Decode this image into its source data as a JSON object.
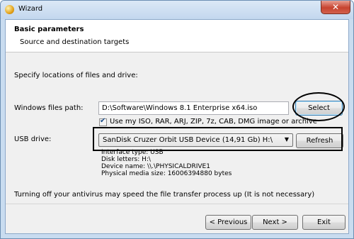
{
  "window": {
    "title": "Wizard",
    "close_label": "✕"
  },
  "header": {
    "title": "Basic parameters",
    "subtitle": "Source and destination targets"
  },
  "main": {
    "instruction": "Specify locations of files and drive:",
    "files_path_label": "Windows files path:",
    "files_path_value": "D:\\Software\\Windows 8.1 Enterprise x64.iso",
    "select_label": "Select",
    "use_images_checked": true,
    "use_images_label": "Use my ISO, RAR, ARJ, ZIP, 7z, CAB, DMG image or archive",
    "usb_label": "USB drive:",
    "usb_selected": "SanDisk Cruzer Orbit USB Device (14,91 Gb) H:\\",
    "refresh_label": "Refresh",
    "drive_info": {
      "interface": "Interface type: USB",
      "letters": "Disk letters: H:\\",
      "device": "Device name: \\\\.\\PHYSICALDRIVE1",
      "size": "Physical media size: 16006394880 bytes"
    },
    "note": "Turning off your antivirus may speed the file transfer process up (It is not necessary)"
  },
  "footer": {
    "previous_label": "< Previous",
    "next_label": "Next >",
    "exit_label": "Exit"
  }
}
